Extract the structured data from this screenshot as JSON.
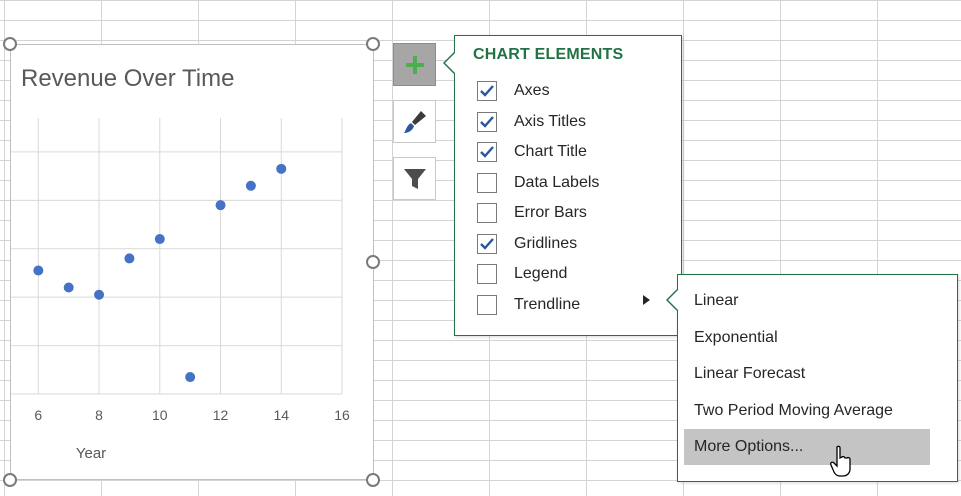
{
  "chart": {
    "title": "Revenue Over Time",
    "xlabel": "Year"
  },
  "chart_data": {
    "type": "scatter",
    "title": "Revenue Over Time",
    "xlabel": "Year",
    "ylabel": "",
    "xticks": [
      6,
      8,
      10,
      12,
      14,
      16
    ],
    "points": [
      {
        "x": 6,
        "y": 3.55
      },
      {
        "x": 7,
        "y": 3.2
      },
      {
        "x": 8,
        "y": 3.05
      },
      {
        "x": 9,
        "y": 3.8
      },
      {
        "x": 10,
        "y": 4.2
      },
      {
        "x": 11,
        "y": 1.35
      },
      {
        "x": 12,
        "y": 4.9
      },
      {
        "x": 13,
        "y": 5.3
      },
      {
        "x": 14,
        "y": 5.65
      }
    ],
    "xlim": [
      5.1,
      16
    ],
    "ylim": [
      1,
      6.7
    ],
    "grid": true,
    "color": "#4472c4"
  },
  "side_buttons": {
    "chart_elements": "plus-icon",
    "chart_styles": "paintbrush-icon",
    "chart_filters": "funnel-icon"
  },
  "panel": {
    "header": "CHART ELEMENTS",
    "options": [
      {
        "label": "Axes",
        "checked": true
      },
      {
        "label": "Axis Titles",
        "checked": true
      },
      {
        "label": "Chart Title",
        "checked": true
      },
      {
        "label": "Data Labels",
        "checked": false
      },
      {
        "label": "Error Bars",
        "checked": false
      },
      {
        "label": "Gridlines",
        "checked": true
      },
      {
        "label": "Legend",
        "checked": false
      },
      {
        "label": "Trendline",
        "checked": false
      }
    ]
  },
  "submenu": {
    "items": [
      "Linear",
      "Exponential",
      "Linear Forecast",
      "Two Period Moving Average",
      "More Options..."
    ],
    "hovered": "More Options..."
  },
  "colors": {
    "accent": "#217346",
    "marker": "#4472c4",
    "check": "#2b579a",
    "hover": "#c4c4c4"
  }
}
